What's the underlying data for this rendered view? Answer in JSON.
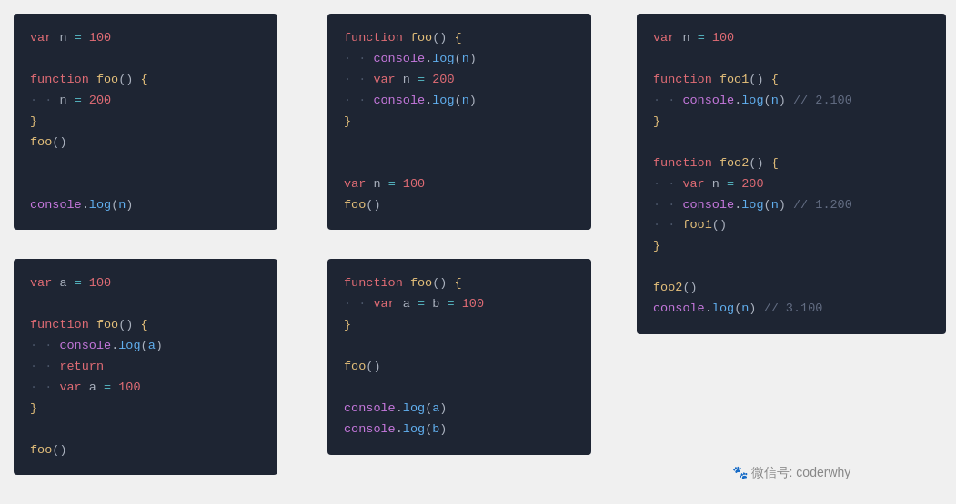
{
  "panels": [
    {
      "id": "panel1",
      "lines": [
        {
          "tokens": [
            {
              "t": "var",
              "c": "kw"
            },
            {
              "t": " "
            },
            {
              "t": "n",
              "c": "varname"
            },
            {
              "t": " "
            },
            {
              "t": "=",
              "c": "eq"
            },
            {
              "t": " "
            },
            {
              "t": "100",
              "c": "num"
            }
          ]
        },
        {
          "tokens": []
        },
        {
          "tokens": [
            {
              "t": "function",
              "c": "kw"
            },
            {
              "t": " "
            },
            {
              "t": "foo",
              "c": "fn"
            },
            {
              "t": "()",
              "c": "paren"
            },
            {
              "t": " ",
              "c": "plain"
            },
            {
              "t": "{",
              "c": "brace"
            }
          ]
        },
        {
          "tokens": [
            {
              "t": "··",
              "c": "indent"
            },
            {
              "t": "n",
              "c": "varname"
            },
            {
              "t": " "
            },
            {
              "t": "=",
              "c": "eq"
            },
            {
              "t": " "
            },
            {
              "t": "200",
              "c": "num"
            }
          ]
        },
        {
          "tokens": [
            {
              "t": "}",
              "c": "brace"
            }
          ]
        },
        {
          "tokens": [
            {
              "t": "foo",
              "c": "fn"
            },
            {
              "t": "()",
              "c": "paren"
            }
          ]
        },
        {
          "tokens": []
        },
        {
          "tokens": []
        },
        {
          "tokens": [
            {
              "t": "console",
              "c": "console-kw"
            },
            {
              "t": ".",
              "c": "dot"
            },
            {
              "t": "log",
              "c": "prop"
            },
            {
              "t": "(",
              "c": "paren"
            },
            {
              "t": "n",
              "c": "param"
            },
            {
              "t": ")",
              "c": "paren"
            }
          ]
        }
      ]
    },
    {
      "id": "panel2",
      "lines": [
        {
          "tokens": [
            {
              "t": "function",
              "c": "kw"
            },
            {
              "t": " "
            },
            {
              "t": "foo",
              "c": "fn"
            },
            {
              "t": "()",
              "c": "paren"
            },
            {
              "t": " ",
              "c": "plain"
            },
            {
              "t": "{",
              "c": "brace"
            }
          ]
        },
        {
          "tokens": [
            {
              "t": "··",
              "c": "indent"
            },
            {
              "t": "console",
              "c": "console-kw"
            },
            {
              "t": ".",
              "c": "dot"
            },
            {
              "t": "log",
              "c": "prop"
            },
            {
              "t": "(",
              "c": "paren"
            },
            {
              "t": "n",
              "c": "param"
            },
            {
              "t": ")",
              "c": "paren"
            }
          ]
        },
        {
          "tokens": [
            {
              "t": "··",
              "c": "indent"
            },
            {
              "t": "var",
              "c": "kw"
            },
            {
              "t": " "
            },
            {
              "t": "n",
              "c": "varname"
            },
            {
              "t": " "
            },
            {
              "t": "=",
              "c": "eq"
            },
            {
              "t": " "
            },
            {
              "t": "200",
              "c": "num"
            }
          ]
        },
        {
          "tokens": [
            {
              "t": "··",
              "c": "indent"
            },
            {
              "t": "console",
              "c": "console-kw"
            },
            {
              "t": ".",
              "c": "dot"
            },
            {
              "t": "log",
              "c": "prop"
            },
            {
              "t": "(",
              "c": "paren"
            },
            {
              "t": "n",
              "c": "param"
            },
            {
              "t": ")",
              "c": "paren"
            }
          ]
        },
        {
          "tokens": [
            {
              "t": "}",
              "c": "brace"
            }
          ]
        },
        {
          "tokens": []
        },
        {
          "tokens": []
        },
        {
          "tokens": [
            {
              "t": "var",
              "c": "kw"
            },
            {
              "t": " "
            },
            {
              "t": "n",
              "c": "varname"
            },
            {
              "t": " "
            },
            {
              "t": "=",
              "c": "eq"
            },
            {
              "t": " "
            },
            {
              "t": "100",
              "c": "num"
            }
          ]
        },
        {
          "tokens": [
            {
              "t": "foo",
              "c": "fn"
            },
            {
              "t": "()",
              "c": "paren"
            }
          ]
        }
      ]
    },
    {
      "id": "panel3",
      "lines": [
        {
          "tokens": [
            {
              "t": "var",
              "c": "kw"
            },
            {
              "t": " "
            },
            {
              "t": "n",
              "c": "varname"
            },
            {
              "t": " "
            },
            {
              "t": "=",
              "c": "eq"
            },
            {
              "t": " "
            },
            {
              "t": "100",
              "c": "num"
            }
          ]
        },
        {
          "tokens": []
        },
        {
          "tokens": [
            {
              "t": "function",
              "c": "kw"
            },
            {
              "t": " "
            },
            {
              "t": "foo1",
              "c": "fn"
            },
            {
              "t": "()",
              "c": "paren"
            },
            {
              "t": " ",
              "c": "plain"
            },
            {
              "t": "{",
              "c": "brace"
            }
          ]
        },
        {
          "tokens": [
            {
              "t": "··",
              "c": "indent"
            },
            {
              "t": "console",
              "c": "console-kw"
            },
            {
              "t": ".",
              "c": "dot"
            },
            {
              "t": "log",
              "c": "prop"
            },
            {
              "t": "(",
              "c": "paren"
            },
            {
              "t": "n",
              "c": "param"
            },
            {
              "t": ")",
              "c": "paren"
            },
            {
              "t": " // 2.100",
              "c": "comment"
            }
          ]
        },
        {
          "tokens": [
            {
              "t": "}",
              "c": "brace"
            }
          ]
        },
        {
          "tokens": []
        },
        {
          "tokens": [
            {
              "t": "function",
              "c": "kw"
            },
            {
              "t": " "
            },
            {
              "t": "foo2",
              "c": "fn"
            },
            {
              "t": "()",
              "c": "paren"
            },
            {
              "t": " ",
              "c": "plain"
            },
            {
              "t": "{",
              "c": "brace"
            }
          ]
        },
        {
          "tokens": [
            {
              "t": "··",
              "c": "indent"
            },
            {
              "t": "var",
              "c": "kw"
            },
            {
              "t": " "
            },
            {
              "t": "n",
              "c": "varname"
            },
            {
              "t": " "
            },
            {
              "t": "=",
              "c": "eq"
            },
            {
              "t": " "
            },
            {
              "t": "200",
              "c": "num"
            }
          ]
        },
        {
          "tokens": [
            {
              "t": "··",
              "c": "indent"
            },
            {
              "t": "console",
              "c": "console-kw"
            },
            {
              "t": ".",
              "c": "dot"
            },
            {
              "t": "log",
              "c": "prop"
            },
            {
              "t": "(",
              "c": "paren"
            },
            {
              "t": "n",
              "c": "param"
            },
            {
              "t": ")",
              "c": "paren"
            },
            {
              "t": " // 1.200",
              "c": "comment"
            }
          ]
        },
        {
          "tokens": [
            {
              "t": "··",
              "c": "indent"
            },
            {
              "t": "foo1",
              "c": "fn"
            },
            {
              "t": "()",
              "c": "paren"
            }
          ]
        },
        {
          "tokens": [
            {
              "t": "}",
              "c": "brace"
            }
          ]
        },
        {
          "tokens": []
        },
        {
          "tokens": [
            {
              "t": "foo2",
              "c": "fn"
            },
            {
              "t": "()",
              "c": "paren"
            }
          ]
        },
        {
          "tokens": [
            {
              "t": "console",
              "c": "console-kw"
            },
            {
              "t": ".",
              "c": "dot"
            },
            {
              "t": "log",
              "c": "prop"
            },
            {
              "t": "(",
              "c": "paren"
            },
            {
              "t": "n",
              "c": "param"
            },
            {
              "t": ")",
              "c": "paren"
            },
            {
              "t": " // 3.100",
              "c": "comment"
            }
          ]
        }
      ]
    },
    {
      "id": "panel4",
      "lines": [
        {
          "tokens": [
            {
              "t": "var",
              "c": "kw"
            },
            {
              "t": " "
            },
            {
              "t": "a",
              "c": "varname"
            },
            {
              "t": " "
            },
            {
              "t": "=",
              "c": "eq"
            },
            {
              "t": " "
            },
            {
              "t": "100",
              "c": "num"
            }
          ]
        },
        {
          "tokens": []
        },
        {
          "tokens": [
            {
              "t": "function",
              "c": "kw"
            },
            {
              "t": " "
            },
            {
              "t": "foo",
              "c": "fn"
            },
            {
              "t": "()",
              "c": "paren"
            },
            {
              "t": " ",
              "c": "plain"
            },
            {
              "t": "{",
              "c": "brace"
            }
          ]
        },
        {
          "tokens": [
            {
              "t": "··",
              "c": "indent"
            },
            {
              "t": "console",
              "c": "console-kw"
            },
            {
              "t": ".",
              "c": "dot"
            },
            {
              "t": "log",
              "c": "prop"
            },
            {
              "t": "(",
              "c": "paren"
            },
            {
              "t": "a",
              "c": "param"
            },
            {
              "t": ")",
              "c": "paren"
            }
          ]
        },
        {
          "tokens": [
            {
              "t": "··",
              "c": "indent"
            },
            {
              "t": "return",
              "c": "kw"
            }
          ]
        },
        {
          "tokens": [
            {
              "t": "··",
              "c": "indent"
            },
            {
              "t": "var",
              "c": "kw"
            },
            {
              "t": " "
            },
            {
              "t": "a",
              "c": "varname"
            },
            {
              "t": " "
            },
            {
              "t": "=",
              "c": "eq"
            },
            {
              "t": " "
            },
            {
              "t": "100",
              "c": "num"
            }
          ]
        },
        {
          "tokens": [
            {
              "t": "}",
              "c": "brace"
            }
          ]
        },
        {
          "tokens": []
        },
        {
          "tokens": [
            {
              "t": "foo",
              "c": "fn"
            },
            {
              "t": "()",
              "c": "paren"
            }
          ]
        }
      ]
    },
    {
      "id": "panel5",
      "lines": [
        {
          "tokens": [
            {
              "t": "function",
              "c": "kw"
            },
            {
              "t": " "
            },
            {
              "t": "foo",
              "c": "fn"
            },
            {
              "t": "()",
              "c": "paren"
            },
            {
              "t": " ",
              "c": "plain"
            },
            {
              "t": "{",
              "c": "brace"
            }
          ]
        },
        {
          "tokens": [
            {
              "t": "··",
              "c": "indent"
            },
            {
              "t": "var",
              "c": "kw"
            },
            {
              "t": " "
            },
            {
              "t": "a",
              "c": "varname"
            },
            {
              "t": " "
            },
            {
              "t": "=",
              "c": "eq"
            },
            {
              "t": " "
            },
            {
              "t": "b",
              "c": "varname"
            },
            {
              "t": " "
            },
            {
              "t": "=",
              "c": "eq"
            },
            {
              "t": " "
            },
            {
              "t": "100",
              "c": "num"
            }
          ]
        },
        {
          "tokens": [
            {
              "t": "}",
              "c": "brace"
            }
          ]
        },
        {
          "tokens": []
        },
        {
          "tokens": [
            {
              "t": "foo",
              "c": "fn"
            },
            {
              "t": "()",
              "c": "paren"
            }
          ]
        },
        {
          "tokens": []
        },
        {
          "tokens": [
            {
              "t": "console",
              "c": "console-kw"
            },
            {
              "t": ".",
              "c": "dot"
            },
            {
              "t": "log",
              "c": "prop"
            },
            {
              "t": "(",
              "c": "paren"
            },
            {
              "t": "a",
              "c": "param"
            },
            {
              "t": ")",
              "c": "paren"
            }
          ]
        },
        {
          "tokens": [
            {
              "t": "console",
              "c": "console-kw"
            },
            {
              "t": ".",
              "c": "dot"
            },
            {
              "t": "log",
              "c": "prop"
            },
            {
              "t": "(",
              "c": "paren"
            },
            {
              "t": "b",
              "c": "param"
            },
            {
              "t": ")",
              "c": "paren"
            }
          ]
        }
      ]
    }
  ],
  "watermark": {
    "icon": "🐾",
    "text": "微信号: coderwhy"
  }
}
